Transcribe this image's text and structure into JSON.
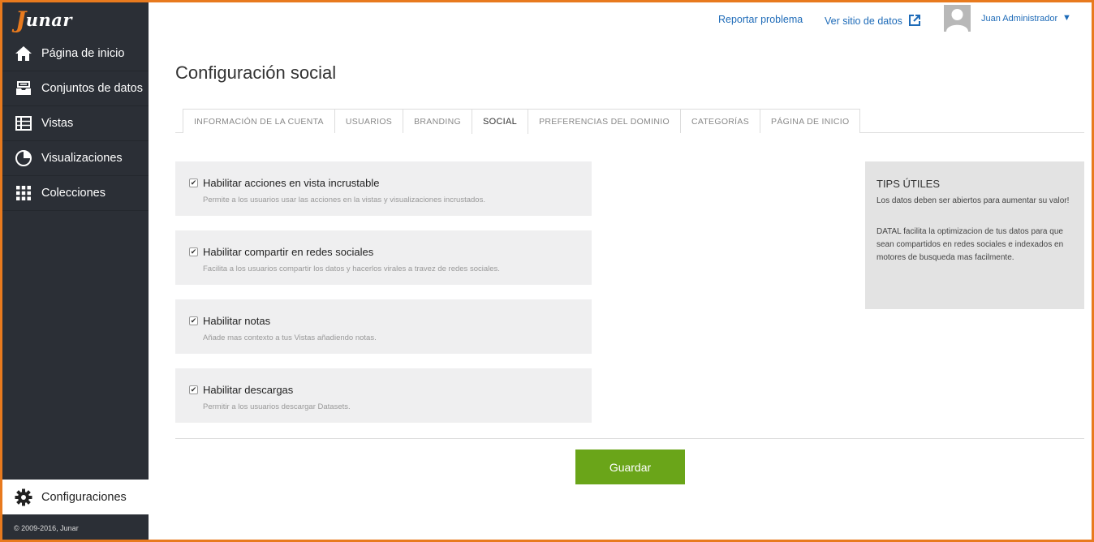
{
  "brand": {
    "name": "unar",
    "initial": "J"
  },
  "sidebar": {
    "items": [
      {
        "label": "Página de inicio",
        "icon": "home-icon"
      },
      {
        "label": "Conjuntos de datos",
        "icon": "inbox-icon"
      },
      {
        "label": "Vistas",
        "icon": "table-icon"
      },
      {
        "label": "Visualizaciones",
        "icon": "pie-chart-icon"
      },
      {
        "label": "Colecciones",
        "icon": "grid-icon"
      }
    ],
    "settings_label": "Configuraciones",
    "copyright": "© 2009-2016, Junar"
  },
  "header": {
    "report_link": "Reportar problema",
    "site_link": "Ver sitio de datos",
    "user_name": "Juan Administrador",
    "caret": "▼"
  },
  "page": {
    "title": "Configuración social"
  },
  "tabs": [
    {
      "label": "INFORMACIÓN DE LA CUENTA"
    },
    {
      "label": "USUARIOS"
    },
    {
      "label": "BRANDING"
    },
    {
      "label": "SOCIAL",
      "active": true
    },
    {
      "label": "PREFERENCIAS DEL DOMINIO"
    },
    {
      "label": "CATEGORÍAS"
    },
    {
      "label": "PÁGINA DE INICIO"
    }
  ],
  "options": [
    {
      "title": "Habilitar acciones en vista incrustable",
      "desc": "Permite a los usuarios usar las acciones en la vistas y visualizaciones incrustados.",
      "checked": true
    },
    {
      "title": "Habilitar compartir en redes sociales",
      "desc": "Facilita a los usuarios compartir los datos y hacerlos virales a travez de redes sociales.",
      "checked": true
    },
    {
      "title": "Habilitar notas",
      "desc": "Añade mas contexto a tus Vistas añadiendo notas.",
      "checked": true
    },
    {
      "title": "Habilitar descargas",
      "desc": "Permitir a los usuarios descargar Datasets.",
      "checked": true
    }
  ],
  "tips": {
    "title": "TIPS ÚTILES",
    "p1": "Los datos deben ser abiertos para aumentar su valor!",
    "p2": "DATAL facilita la optimizacion de tus datos para que sean compartidos en redes sociales e indexados en motores de busqueda mas facilmente."
  },
  "save_label": "Guardar",
  "colors": {
    "sidebar": "#2b2f36",
    "accent": "#6aa519",
    "link": "#1e6bb8",
    "frame": "#e87a1e"
  }
}
